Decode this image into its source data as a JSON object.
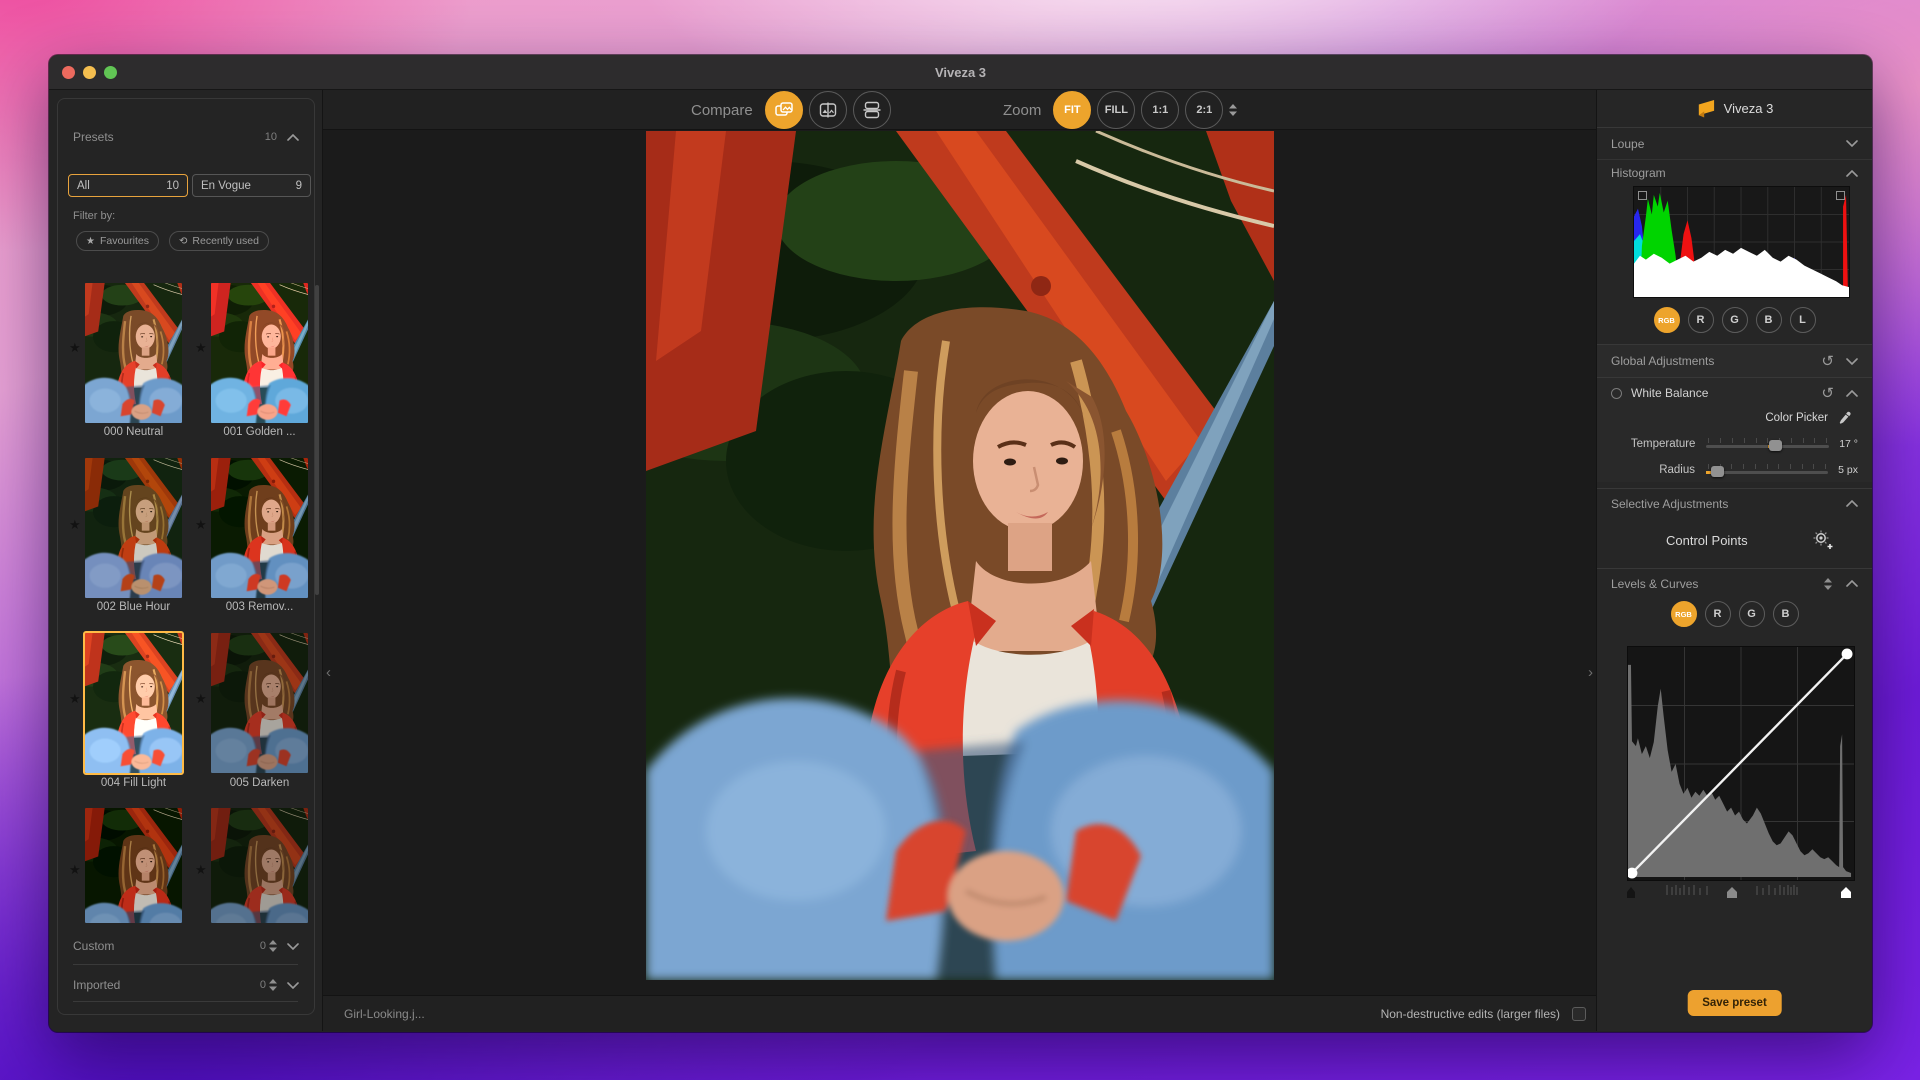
{
  "titlebar": {
    "title": "Viveza 3"
  },
  "toolbar": {
    "compare_label": "Compare",
    "zoom_label": "Zoom",
    "fit": "FIT",
    "fill": "FILL",
    "one_one": "1:1",
    "two_one": "2:1"
  },
  "presets": {
    "title": "Presets",
    "count": "10",
    "tabs": [
      {
        "label": "All",
        "count": "10"
      },
      {
        "label": "En Vogue",
        "count": "9"
      }
    ],
    "filter_by": "Filter by:",
    "favourites": "Favourites",
    "recently_used": "Recently used",
    "items": [
      {
        "label": "000 Neutral"
      },
      {
        "label": "001 Golden ..."
      },
      {
        "label": "002 Blue Hour"
      },
      {
        "label": "003 Remov..."
      },
      {
        "label": "004 Fill Light"
      },
      {
        "label": "005 Darken"
      }
    ],
    "custom": {
      "label": "Custom",
      "count": "0"
    },
    "imported": {
      "label": "Imported",
      "count": "0"
    }
  },
  "right_panel": {
    "app_title": "Viveza 3",
    "loupe": "Loupe",
    "histogram": {
      "title": "Histogram",
      "channels": [
        "RGB",
        "R",
        "G",
        "B",
        "L"
      ]
    },
    "global_adjustments": "Global Adjustments",
    "white_balance": {
      "title": "White Balance",
      "color_picker": "Color Picker",
      "temperature_label": "Temperature",
      "temperature_value": "17 °",
      "radius_label": "Radius",
      "radius_value": "5 px"
    },
    "selective_adjustments": "Selective Adjustments",
    "control_points": "Control Points",
    "levels_curves": {
      "title": "Levels & Curves",
      "channels": [
        "RGB",
        "R",
        "G",
        "B"
      ]
    },
    "save_preset": "Save preset"
  },
  "statusbar": {
    "filename": "Girl-Looking.j...",
    "nondestructive": "Non-destructive edits (larger files)"
  },
  "icons": {
    "reset": "↺",
    "history": "⟲",
    "star": "★",
    "chevron_left": "‹",
    "chevron_right": "›"
  },
  "colors": {
    "accent": "#EDA42C",
    "selection": "#E8A33D",
    "save_button": "#EDA12F"
  }
}
